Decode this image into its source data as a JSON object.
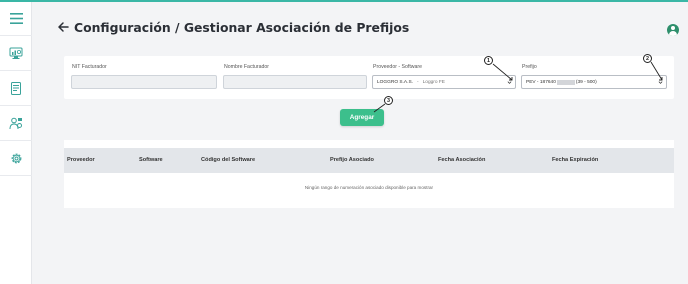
{
  "page": {
    "title": "Configuración / Gestionar Asociación de Prefijos"
  },
  "sidebar": {
    "items": [
      {
        "icon": "menu-icon"
      },
      {
        "icon": "dashboard-monitor-icon"
      },
      {
        "icon": "document-list-icon"
      },
      {
        "icon": "users-config-icon"
      },
      {
        "icon": "gear-icon"
      }
    ]
  },
  "filters": {
    "nit": {
      "label": "NIT Facturador",
      "value": ""
    },
    "nombre": {
      "label": "Nombre Facturador",
      "value": ""
    },
    "proveedor": {
      "label": "Proveedor - Software",
      "provider": "LOGGRO S.A.S.",
      "separator": "-",
      "software": "Loggro FE"
    },
    "prefijo": {
      "label": "Prefijo",
      "prefix": "PEV - 187640",
      "range": "(39 - 500)"
    }
  },
  "annotations": [
    "1",
    "2",
    "3"
  ],
  "actions": {
    "add_label": "Agregar"
  },
  "table": {
    "columns": [
      "Proveedor",
      "Software",
      "Código del Software",
      "Prefijo Asociado",
      "Fecha Asociación",
      "Fecha Expiración"
    ],
    "empty_message": "Ningún rango de numeración asociado disponible para mostrar"
  },
  "colors": {
    "accent": "#3cbf8c",
    "topline": "#3ab7a6",
    "sidebar_icon": "#3aa39a"
  }
}
